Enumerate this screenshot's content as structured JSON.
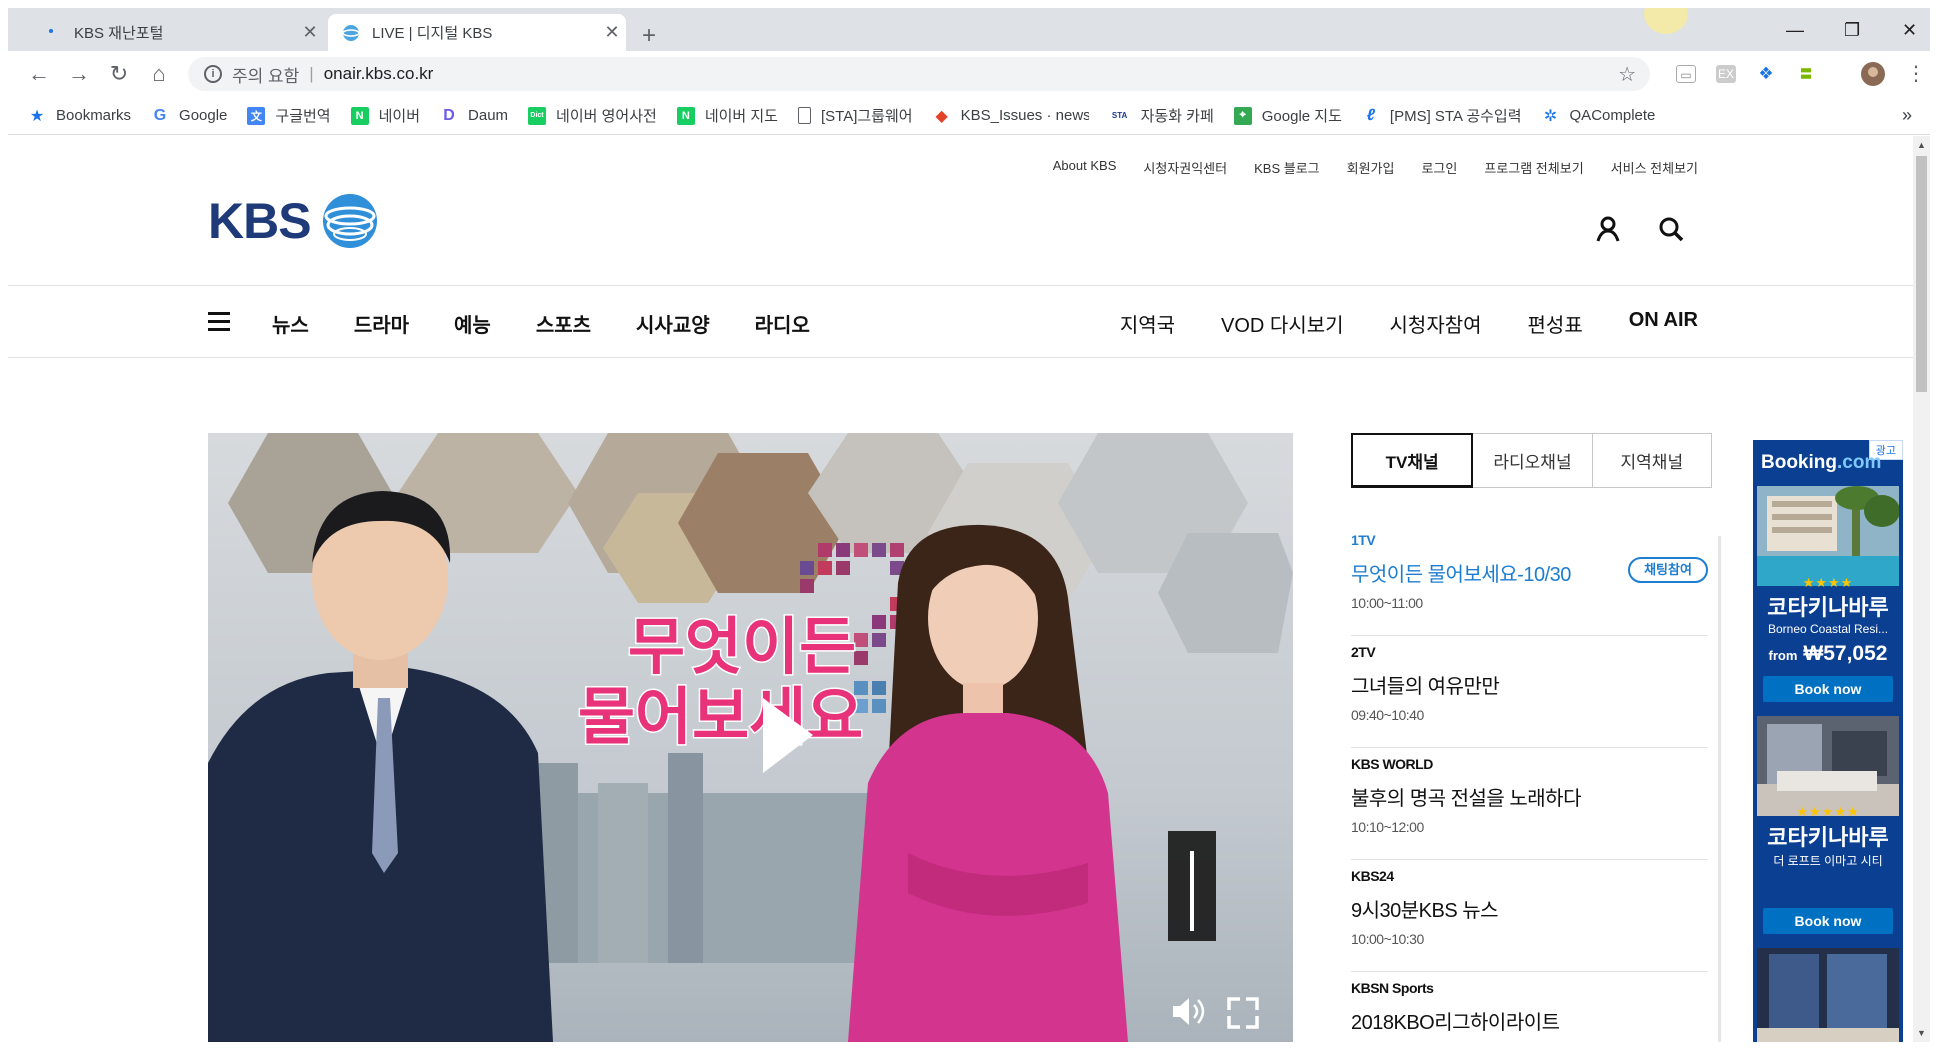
{
  "browser": {
    "tabs": [
      {
        "title": "KBS 재난포털",
        "active": false
      },
      {
        "title": "LIVE | 디지털 KBS",
        "active": true
      }
    ],
    "new_tab": "+",
    "omnibox": {
      "warning": "주의 요함",
      "separator": "|",
      "url": "onair.kbs.co.kr"
    },
    "bookmarks": [
      {
        "label": "Bookmarks",
        "icon": "star-icon"
      },
      {
        "label": "Google",
        "icon": "google-icon"
      },
      {
        "label": "구글번역",
        "icon": "translate-icon"
      },
      {
        "label": "네이버",
        "icon": "naver-icon"
      },
      {
        "label": "Daum",
        "icon": "daum-icon"
      },
      {
        "label": "네이버 영어사전",
        "icon": "dictionary-icon"
      },
      {
        "label": "네이버 지도",
        "icon": "naver-icon"
      },
      {
        "label": "[STA]그룹웨어",
        "icon": "page-icon"
      },
      {
        "label": "KBS_Issues · news / ",
        "icon": "gitlab-icon"
      },
      {
        "label": "자동화 카페",
        "icon": "sta-icon"
      },
      {
        "label": "Google 지도",
        "icon": "maps-icon"
      },
      {
        "label": "[PMS] STA 공수입력",
        "icon": "pms-icon"
      },
      {
        "label": "QAComplete",
        "icon": "qacomplete-icon"
      }
    ],
    "more": "»"
  },
  "header": {
    "util_links": [
      "About KBS",
      "시청자권익센터",
      "KBS 블로그",
      "회원가입",
      "로그인",
      "프로그램 전체보기",
      "서비스 전체보기"
    ],
    "logo_text": "KBS"
  },
  "gnb": {
    "left": [
      "뉴스",
      "드라마",
      "예능",
      "스포츠",
      "시사교양",
      "라디오"
    ],
    "right": [
      "지역국",
      "VOD 다시보기",
      "시청자참여",
      "편성표"
    ],
    "onair": "ON AIR"
  },
  "player": {
    "title_line1": "무엇이든",
    "title_line2": "물어보세요",
    "volume_level": 1.0
  },
  "channel_tabs": [
    "TV채널",
    "라디오채널",
    "지역채널"
  ],
  "channels": [
    {
      "channel": "1TV",
      "program": "무엇이든 물어보세요-10/30",
      "time": "10:00~11:00",
      "live": true,
      "chat_label": "채팅참여"
    },
    {
      "channel": "2TV",
      "program": "그녀들의 여유만만",
      "time": "09:40~10:40",
      "live": false
    },
    {
      "channel": "KBS WORLD",
      "program": "불후의 명곡 전설을 노래하다",
      "time": "10:10~12:00",
      "live": false
    },
    {
      "channel": "KBS24",
      "program": "9시30분KBS 뉴스",
      "time": "10:00~10:30",
      "live": false
    },
    {
      "channel": "KBSN Sports",
      "program": "2018KBO리그하이라이트",
      "time": "",
      "live": false
    }
  ],
  "ad": {
    "tag": "광고",
    "brand_main": "Booking",
    "brand_dot": ".com",
    "offers": [
      {
        "name": "코타키나바루",
        "sub": "Borneo Coastal Resi...",
        "price_prefix": "from",
        "price": "₩57,052",
        "stars": "★★★★",
        "button": "Book now"
      },
      {
        "name": "코타키나바루",
        "sub": "더 로프트 이마고 시티",
        "stars": "★★★★★",
        "button": "Book now"
      }
    ]
  }
}
